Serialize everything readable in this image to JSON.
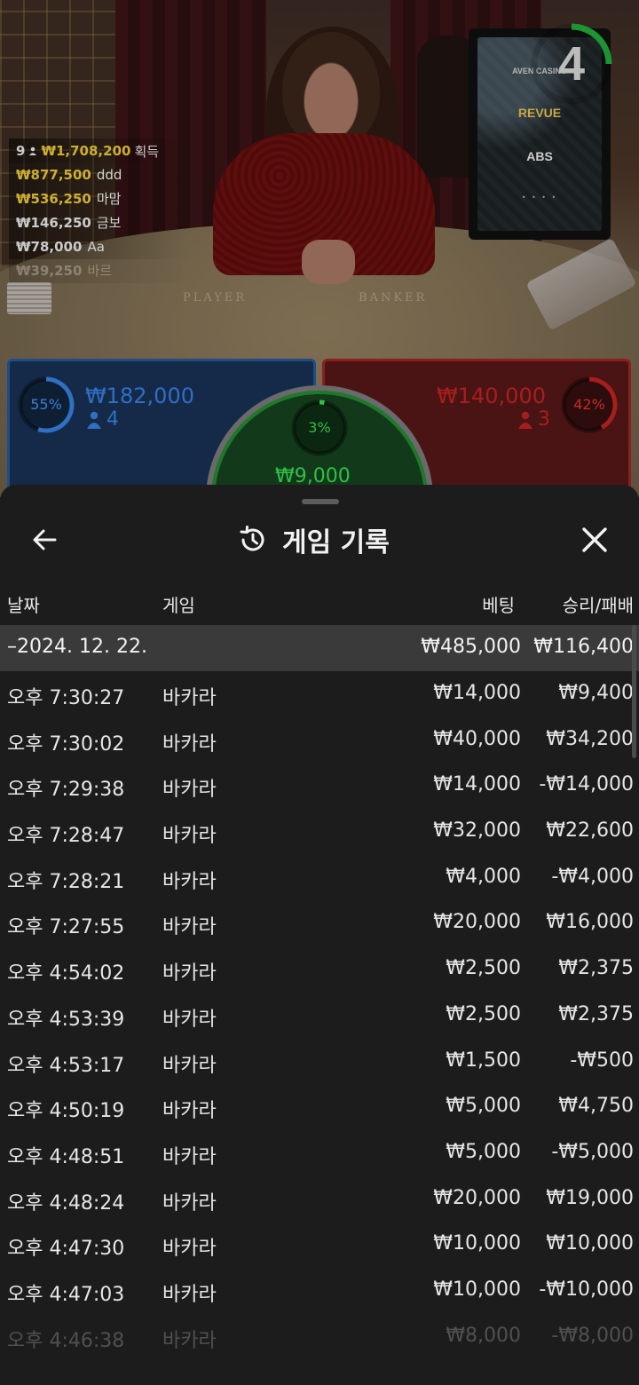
{
  "video": {
    "timer": "4",
    "timer_color": "#1faa3a",
    "player_label": "PLAYER",
    "banker_label": "BANKER",
    "board_logos": [
      "AVEN CASINO",
      "REVUE",
      "ABS"
    ],
    "board_dots": "• • • •",
    "winners": {
      "count": "9",
      "amount": "₩1,708,200",
      "label": "획득",
      "rows": [
        {
          "amount": "₩877,500",
          "name": "ddd",
          "style": "gold"
        },
        {
          "amount": "₩536,250",
          "name": "마맘",
          "style": "gold"
        },
        {
          "amount": "₩146,250",
          "name": "금보",
          "style": "white"
        },
        {
          "amount": "₩78,000",
          "name": "Aa",
          "style": "white"
        },
        {
          "amount": "₩39,250",
          "name": "바르",
          "style": "white fade"
        }
      ]
    },
    "player_bet": {
      "percent": "55%",
      "percent_value": 55,
      "amount": "₩182,000",
      "people": "4",
      "color": "#2f6fc4"
    },
    "banker_bet": {
      "percent": "42%",
      "percent_value": 42,
      "amount": "₩140,000",
      "people": "3",
      "color": "#a81e1e"
    },
    "tie_bet": {
      "percent": "3%",
      "percent_value": 3,
      "amount": "₩9,000",
      "color": "#2fbf45"
    }
  },
  "sheet": {
    "title": "게임 기록",
    "columns": {
      "date": "날짜",
      "game": "게임",
      "bet": "베팅",
      "winloss": "승리/패배"
    },
    "summary": {
      "date": "–2024. 12. 22.",
      "bet": "₩485,000",
      "winloss": "₩116,400"
    },
    "rows": [
      {
        "time": "오후 7:30:27",
        "game": "바카라",
        "bet": "₩14,000",
        "winloss": "₩9,400"
      },
      {
        "time": "오후 7:30:02",
        "game": "바카라",
        "bet": "₩40,000",
        "winloss": "₩34,200"
      },
      {
        "time": "오후 7:29:38",
        "game": "바카라",
        "bet": "₩14,000",
        "winloss": "-₩14,000"
      },
      {
        "time": "오후 7:28:47",
        "game": "바카라",
        "bet": "₩32,000",
        "winloss": "₩22,600"
      },
      {
        "time": "오후 7:28:21",
        "game": "바카라",
        "bet": "₩4,000",
        "winloss": "-₩4,000"
      },
      {
        "time": "오후 7:27:55",
        "game": "바카라",
        "bet": "₩20,000",
        "winloss": "₩16,000"
      },
      {
        "time": "오후 4:54:02",
        "game": "바카라",
        "bet": "₩2,500",
        "winloss": "₩2,375"
      },
      {
        "time": "오후 4:53:39",
        "game": "바카라",
        "bet": "₩2,500",
        "winloss": "₩2,375"
      },
      {
        "time": "오후 4:53:17",
        "game": "바카라",
        "bet": "₩1,500",
        "winloss": "-₩500"
      },
      {
        "time": "오후 4:50:19",
        "game": "바카라",
        "bet": "₩5,000",
        "winloss": "₩4,750"
      },
      {
        "time": "오후 4:48:51",
        "game": "바카라",
        "bet": "₩5,000",
        "winloss": "-₩5,000"
      },
      {
        "time": "오후 4:48:24",
        "game": "바카라",
        "bet": "₩20,000",
        "winloss": "₩19,000"
      },
      {
        "time": "오후 4:47:30",
        "game": "바카라",
        "bet": "₩10,000",
        "winloss": "₩10,000"
      },
      {
        "time": "오후 4:47:03",
        "game": "바카라",
        "bet": "₩10,000",
        "winloss": "-₩10,000"
      },
      {
        "time": "오후 4:46:38",
        "game": "바카라",
        "bet": "₩8,000",
        "winloss": "-₩8,000"
      }
    ]
  }
}
